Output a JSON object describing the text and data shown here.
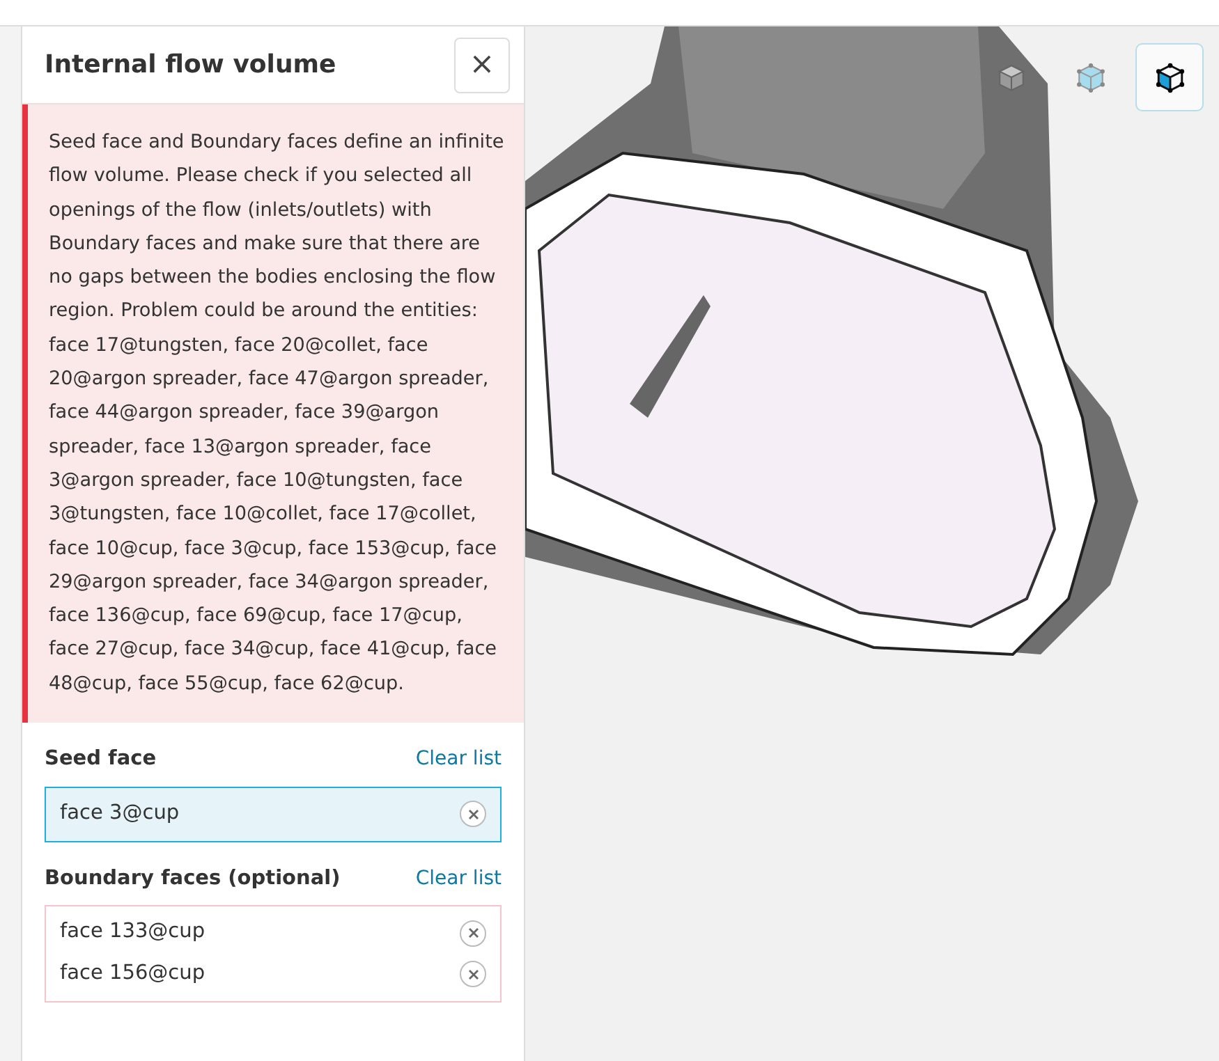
{
  "panel": {
    "title": "Internal flow volume",
    "close": "×",
    "error": "Seed face and Boundary faces define an infinite flow volume. Please check if you selected all openings of the flow (inlets/outlets) with Boundary faces and make sure that there are no gaps between the bodies enclosing the flow region. Problem could be around the entities: face 17@tungsten, face 20@collet, face 20@argon spreader, face 47@argon spreader, face 44@argon spreader, face 39@argon spreader, face 13@argon spreader, face 3@argon spreader, face 10@tungsten, face 3@tungsten, face 10@collet, face 17@collet, face 10@cup, face 3@cup, face 153@cup, face 29@argon spreader, face 34@argon spreader, face 136@cup, face 69@cup, face 17@cup, face 27@cup, face 34@cup, face 41@cup, face 48@cup, face 55@cup, face 62@cup.",
    "sections": [
      {
        "label": "Seed face",
        "action": "Clear list",
        "active": true,
        "items": [
          "face 3@cup"
        ]
      },
      {
        "label": "Boundary faces (optional)",
        "action": "Clear list",
        "active": false,
        "items": [
          "face 133@cup",
          "face 156@cup"
        ]
      }
    ]
  },
  "view_buttons": [
    {
      "kind": "solid",
      "selected": false
    },
    {
      "kind": "transparent",
      "selected": false
    },
    {
      "kind": "edges",
      "selected": true
    }
  ]
}
